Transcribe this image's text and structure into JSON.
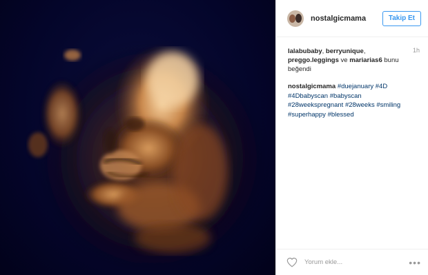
{
  "header": {
    "username": "nostalgicmama",
    "follow_label": "Takip Et"
  },
  "likes": {
    "users": [
      "lalabubaby",
      "berryunique",
      "preggo.leggings",
      "mariarias6"
    ],
    "sep1": ", ",
    "sep2": ", ",
    "connector": " ve ",
    "suffix": " bunu beğendi",
    "time": "1h"
  },
  "caption": {
    "author": "nostalgicmama",
    "tags": [
      "#duejanuary",
      "#4D",
      "#4Dbabyscan",
      "#babyscan",
      "#28weekspregnant",
      "#28weeks",
      "#smiling",
      "#superhappy",
      "#blessed"
    ]
  },
  "footer": {
    "comment_placeholder": "Yorum ekle...",
    "more_label": "•••",
    "heart_icon": "heart-outline-icon"
  },
  "media": {
    "subject": "4D baby ultrasound scan",
    "tint": "#c8864a",
    "background": "#04052a"
  }
}
